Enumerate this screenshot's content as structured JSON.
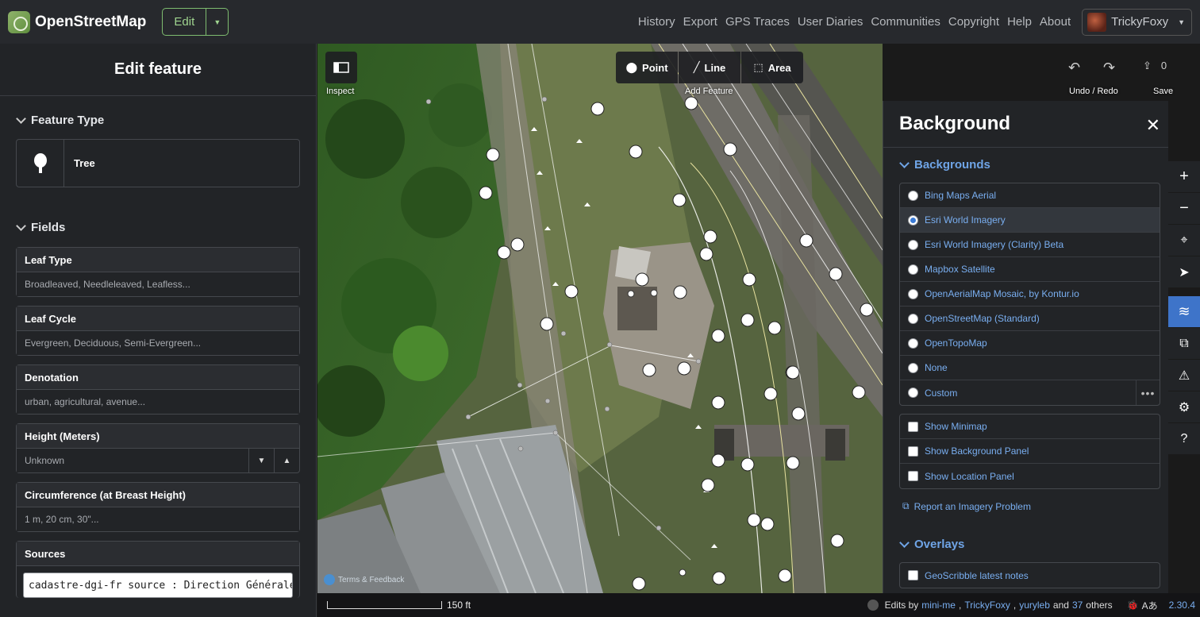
{
  "topbar": {
    "brand": "OpenStreetMap",
    "edit_label": "Edit",
    "nav": [
      "History",
      "Export",
      "GPS Traces",
      "User Diaries",
      "Communities",
      "Copyright",
      "Help",
      "About"
    ],
    "username": "TrickyFoxy"
  },
  "sidebar": {
    "title": "Edit feature",
    "feature_type_title": "Feature Type",
    "preset_name": "Tree",
    "fields_title": "Fields",
    "fields": [
      {
        "label": "Leaf Type",
        "placeholder": "Broadleaved, Needleleaved, Leafless..."
      },
      {
        "label": "Leaf Cycle",
        "placeholder": "Evergreen, Deciduous, Semi-Evergreen..."
      },
      {
        "label": "Denotation",
        "placeholder": "urban, agricultural, avenue..."
      },
      {
        "label": "Height (Meters)",
        "placeholder": "Unknown"
      },
      {
        "label": "Circumference (at Breast Height)",
        "placeholder": "1 m, 20 cm, 30\"..."
      },
      {
        "label": "Sources",
        "value": "cadastre-dgi-fr source : Direction Générale"
      }
    ]
  },
  "toolbar": {
    "inspect_label": "Inspect",
    "point_label": "Point",
    "line_label": "Line",
    "area_label": "Area",
    "add_feature_label": "Add Feature",
    "undo_redo_label": "Undo / Redo",
    "save_label": "Save",
    "save_count": "0"
  },
  "background": {
    "title": "Background",
    "backgrounds_title": "Backgrounds",
    "sources": [
      {
        "name": "Bing Maps Aerial",
        "selected": false
      },
      {
        "name": "Esri World Imagery",
        "selected": true
      },
      {
        "name": "Esri World Imagery (Clarity) Beta",
        "selected": false
      },
      {
        "name": "Mapbox Satellite",
        "selected": false
      },
      {
        "name": "OpenAerialMap Mosaic, by Kontur.io",
        "selected": false
      },
      {
        "name": "OpenStreetMap (Standard)",
        "selected": false
      },
      {
        "name": "OpenTopoMap",
        "selected": false
      },
      {
        "name": "None",
        "selected": false
      },
      {
        "name": "Custom",
        "selected": false
      }
    ],
    "options": [
      "Show Minimap",
      "Show Background Panel",
      "Show Location Panel"
    ],
    "report_label": "Report an Imagery Problem",
    "overlays_title": "Overlays",
    "overlays": [
      "GeoScribble latest notes"
    ]
  },
  "map": {
    "terms_label": "Terms & Feedback"
  },
  "footer": {
    "scale_label": "150 ft",
    "edits_prefix": "Edits by",
    "editor1": "mini-me",
    "editor2": "TrickyFoxy",
    "editor3": "yuryleb",
    "and_text": "and",
    "others_count": "37",
    "others_text": "others",
    "version": "2.30.4"
  },
  "colors": {
    "accent": "#3e74c9",
    "link": "#79aef0",
    "edit_green": "#7ebc6f"
  }
}
